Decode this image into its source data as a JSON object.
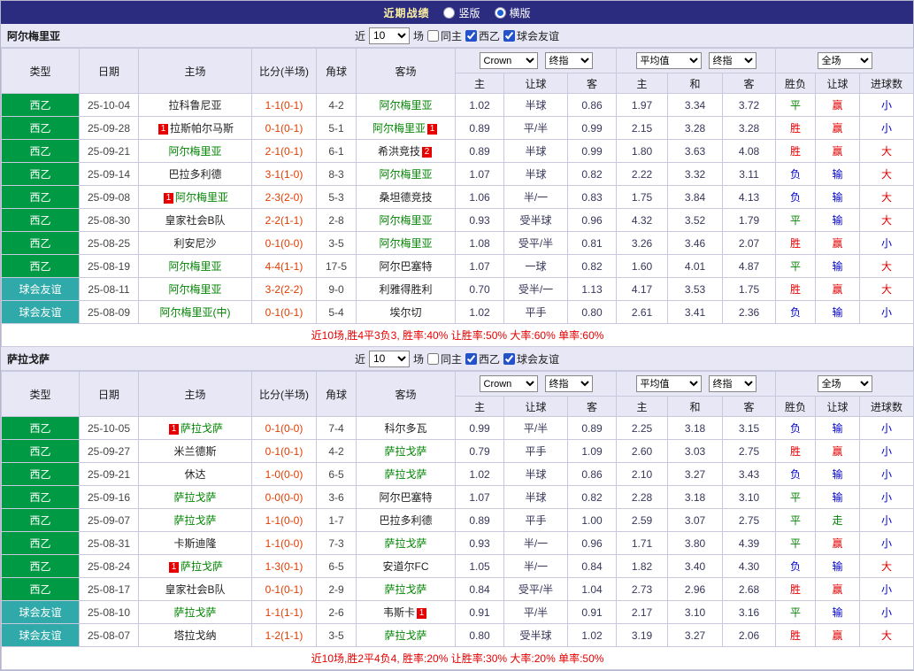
{
  "topbar": {
    "title": "近期战绩",
    "radios": [
      {
        "label": "竖版",
        "selected": false
      },
      {
        "label": "横版",
        "selected": true
      }
    ]
  },
  "focus_color": "#028402",
  "type_colors": {
    "西乙": "#009944",
    "球会友谊": "#2fa9a9"
  },
  "value_colors": {
    "胜": "#e60000",
    "平": "#028402",
    "负": "#0000cc",
    "赢": "#e60000",
    "输": "#0000cc",
    "走": "#028402",
    "大": "#e60000",
    "小": "#0000cc"
  },
  "sections": [
    {
      "team": "阿尔梅里亚",
      "filter": {
        "pre": "近",
        "count": "10",
        "post": "场",
        "checks": [
          {
            "label": "同主",
            "checked": false
          },
          {
            "label": "西乙",
            "checked": true
          },
          {
            "label": "球会友谊",
            "checked": true
          }
        ]
      },
      "controls": {
        "odds_source": "Crown",
        "odds_time": "终指",
        "euro_source": "平均值",
        "euro_time": "终指",
        "scope": "全场"
      },
      "columns": {
        "type": "类型",
        "date": "日期",
        "home": "主场",
        "score": "比分(半场)",
        "corner": "角球",
        "away": "客场",
        "ah": [
          "主",
          "让球",
          "客"
        ],
        "eu": [
          "主",
          "和",
          "客"
        ],
        "res": [
          "胜负",
          "让球",
          "进球数"
        ]
      },
      "rows": [
        {
          "type": "西乙",
          "date": "25-10-04",
          "home": {
            "name": "拉科鲁尼亚"
          },
          "score": "1-1(0-1)",
          "corner": "4-2",
          "away": {
            "name": "阿尔梅里亚",
            "focus": true
          },
          "ah": [
            "1.02",
            "半球",
            "0.86"
          ],
          "eu": [
            "1.97",
            "3.34",
            "3.72"
          ],
          "res": "平",
          "let": "赢",
          "goal": "小"
        },
        {
          "type": "西乙",
          "date": "25-09-28",
          "home": {
            "name": "拉斯帕尔马斯",
            "pre": "1"
          },
          "score": "0-1(0-1)",
          "corner": "5-1",
          "away": {
            "name": "阿尔梅里亚",
            "focus": true,
            "post": "1"
          },
          "ah": [
            "0.89",
            "平/半",
            "0.99"
          ],
          "eu": [
            "2.15",
            "3.28",
            "3.28"
          ],
          "res": "胜",
          "let": "赢",
          "goal": "小"
        },
        {
          "type": "西乙",
          "date": "25-09-21",
          "home": {
            "name": "阿尔梅里亚",
            "focus": true
          },
          "score": "2-1(0-1)",
          "corner": "6-1",
          "away": {
            "name": "希洪竞技",
            "post": "2"
          },
          "ah": [
            "0.89",
            "半球",
            "0.99"
          ],
          "eu": [
            "1.80",
            "3.63",
            "4.08"
          ],
          "res": "胜",
          "let": "赢",
          "goal": "大"
        },
        {
          "type": "西乙",
          "date": "25-09-14",
          "home": {
            "name": "巴拉多利德"
          },
          "score": "3-1(1-0)",
          "corner": "8-3",
          "away": {
            "name": "阿尔梅里亚",
            "focus": true
          },
          "ah": [
            "1.07",
            "半球",
            "0.82"
          ],
          "eu": [
            "2.22",
            "3.32",
            "3.11"
          ],
          "res": "负",
          "let": "输",
          "goal": "大"
        },
        {
          "type": "西乙",
          "date": "25-09-08",
          "home": {
            "name": "阿尔梅里亚",
            "focus": true,
            "pre": "1"
          },
          "score": "2-3(2-0)",
          "corner": "5-3",
          "away": {
            "name": "桑坦德竞技"
          },
          "ah": [
            "1.06",
            "半/一",
            "0.83"
          ],
          "eu": [
            "1.75",
            "3.84",
            "4.13"
          ],
          "res": "负",
          "let": "输",
          "goal": "大"
        },
        {
          "type": "西乙",
          "date": "25-08-30",
          "home": {
            "name": "皇家社会B队"
          },
          "score": "2-2(1-1)",
          "corner": "2-8",
          "away": {
            "name": "阿尔梅里亚",
            "focus": true
          },
          "ah": [
            "0.93",
            "受半球",
            "0.96"
          ],
          "eu": [
            "4.32",
            "3.52",
            "1.79"
          ],
          "res": "平",
          "let": "输",
          "goal": "大"
        },
        {
          "type": "西乙",
          "date": "25-08-25",
          "home": {
            "name": "利安尼沙"
          },
          "score": "0-1(0-0)",
          "corner": "3-5",
          "away": {
            "name": "阿尔梅里亚",
            "focus": true
          },
          "ah": [
            "1.08",
            "受平/半",
            "0.81"
          ],
          "eu": [
            "3.26",
            "3.46",
            "2.07"
          ],
          "res": "胜",
          "let": "赢",
          "goal": "小"
        },
        {
          "type": "西乙",
          "date": "25-08-19",
          "home": {
            "name": "阿尔梅里亚",
            "focus": true
          },
          "score": "4-4(1-1)",
          "corner": "17-5",
          "away": {
            "name": "阿尔巴塞特"
          },
          "ah": [
            "1.07",
            "一球",
            "0.82"
          ],
          "eu": [
            "1.60",
            "4.01",
            "4.87"
          ],
          "res": "平",
          "let": "输",
          "goal": "大"
        },
        {
          "type": "球会友谊",
          "date": "25-08-11",
          "home": {
            "name": "阿尔梅里亚",
            "focus": true
          },
          "score": "3-2(2-2)",
          "corner": "9-0",
          "away": {
            "name": "利雅得胜利"
          },
          "ah": [
            "0.70",
            "受半/一",
            "1.13"
          ],
          "eu": [
            "4.17",
            "3.53",
            "1.75"
          ],
          "res": "胜",
          "let": "赢",
          "goal": "大"
        },
        {
          "type": "球会友谊",
          "date": "25-08-09",
          "home": {
            "name": "阿尔梅里亚(中)",
            "focus": true
          },
          "score": "0-1(0-1)",
          "corner": "5-4",
          "away": {
            "name": "埃尔切"
          },
          "ah": [
            "1.02",
            "平手",
            "0.80"
          ],
          "eu": [
            "2.61",
            "3.41",
            "2.36"
          ],
          "res": "负",
          "let": "输",
          "goal": "小"
        }
      ],
      "summary": "近10场,胜4平3负3, 胜率:40% 让胜率:50% 大率:60% 单率:60%"
    },
    {
      "team": "萨拉戈萨",
      "filter": {
        "pre": "近",
        "count": "10",
        "post": "场",
        "checks": [
          {
            "label": "同主",
            "checked": false
          },
          {
            "label": "西乙",
            "checked": true
          },
          {
            "label": "球会友谊",
            "checked": true
          }
        ]
      },
      "controls": {
        "odds_source": "Crown",
        "odds_time": "终指",
        "euro_source": "平均值",
        "euro_time": "终指",
        "scope": "全场"
      },
      "columns": {
        "type": "类型",
        "date": "日期",
        "home": "主场",
        "score": "比分(半场)",
        "corner": "角球",
        "away": "客场",
        "ah": [
          "主",
          "让球",
          "客"
        ],
        "eu": [
          "主",
          "和",
          "客"
        ],
        "res": [
          "胜负",
          "让球",
          "进球数"
        ]
      },
      "rows": [
        {
          "type": "西乙",
          "date": "25-10-05",
          "home": {
            "name": "萨拉戈萨",
            "focus": true,
            "pre": "1"
          },
          "score": "0-1(0-0)",
          "corner": "7-4",
          "away": {
            "name": "科尔多瓦"
          },
          "ah": [
            "0.99",
            "平/半",
            "0.89"
          ],
          "eu": [
            "2.25",
            "3.18",
            "3.15"
          ],
          "res": "负",
          "let": "输",
          "goal": "小"
        },
        {
          "type": "西乙",
          "date": "25-09-27",
          "home": {
            "name": "米兰德斯"
          },
          "score": "0-1(0-1)",
          "corner": "4-2",
          "away": {
            "name": "萨拉戈萨",
            "focus": true
          },
          "ah": [
            "0.79",
            "平手",
            "1.09"
          ],
          "eu": [
            "2.60",
            "3.03",
            "2.75"
          ],
          "res": "胜",
          "let": "赢",
          "goal": "小"
        },
        {
          "type": "西乙",
          "date": "25-09-21",
          "home": {
            "name": "休达"
          },
          "score": "1-0(0-0)",
          "corner": "6-5",
          "away": {
            "name": "萨拉戈萨",
            "focus": true
          },
          "ah": [
            "1.02",
            "半球",
            "0.86"
          ],
          "eu": [
            "2.10",
            "3.27",
            "3.43"
          ],
          "res": "负",
          "let": "输",
          "goal": "小"
        },
        {
          "type": "西乙",
          "date": "25-09-16",
          "home": {
            "name": "萨拉戈萨",
            "focus": true
          },
          "score": "0-0(0-0)",
          "corner": "3-6",
          "away": {
            "name": "阿尔巴塞特"
          },
          "ah": [
            "1.07",
            "半球",
            "0.82"
          ],
          "eu": [
            "2.28",
            "3.18",
            "3.10"
          ],
          "res": "平",
          "let": "输",
          "goal": "小"
        },
        {
          "type": "西乙",
          "date": "25-09-07",
          "home": {
            "name": "萨拉戈萨",
            "focus": true
          },
          "score": "1-1(0-0)",
          "corner": "1-7",
          "away": {
            "name": "巴拉多利德"
          },
          "ah": [
            "0.89",
            "平手",
            "1.00"
          ],
          "eu": [
            "2.59",
            "3.07",
            "2.75"
          ],
          "res": "平",
          "let": "走",
          "goal": "小"
        },
        {
          "type": "西乙",
          "date": "25-08-31",
          "home": {
            "name": "卡斯迪隆"
          },
          "score": "1-1(0-0)",
          "corner": "7-3",
          "away": {
            "name": "萨拉戈萨",
            "focus": true
          },
          "ah": [
            "0.93",
            "半/一",
            "0.96"
          ],
          "eu": [
            "1.71",
            "3.80",
            "4.39"
          ],
          "res": "平",
          "let": "赢",
          "goal": "小"
        },
        {
          "type": "西乙",
          "date": "25-08-24",
          "home": {
            "name": "萨拉戈萨",
            "focus": true,
            "pre": "1"
          },
          "score": "1-3(0-1)",
          "corner": "6-5",
          "away": {
            "name": "安道尔FC"
          },
          "ah": [
            "1.05",
            "半/一",
            "0.84"
          ],
          "eu": [
            "1.82",
            "3.40",
            "4.30"
          ],
          "res": "负",
          "let": "输",
          "goal": "大"
        },
        {
          "type": "西乙",
          "date": "25-08-17",
          "home": {
            "name": "皇家社会B队"
          },
          "score": "0-1(0-1)",
          "corner": "2-9",
          "away": {
            "name": "萨拉戈萨",
            "focus": true
          },
          "ah": [
            "0.84",
            "受平/半",
            "1.04"
          ],
          "eu": [
            "2.73",
            "2.96",
            "2.68"
          ],
          "res": "胜",
          "let": "赢",
          "goal": "小"
        },
        {
          "type": "球会友谊",
          "date": "25-08-10",
          "home": {
            "name": "萨拉戈萨",
            "focus": true
          },
          "score": "1-1(1-1)",
          "corner": "2-6",
          "away": {
            "name": "韦斯卡",
            "post": "1"
          },
          "ah": [
            "0.91",
            "平/半",
            "0.91"
          ],
          "eu": [
            "2.17",
            "3.10",
            "3.16"
          ],
          "res": "平",
          "let": "输",
          "goal": "小"
        },
        {
          "type": "球会友谊",
          "date": "25-08-07",
          "home": {
            "name": "塔拉戈纳"
          },
          "score": "1-2(1-1)",
          "corner": "3-5",
          "away": {
            "name": "萨拉戈萨",
            "focus": true
          },
          "ah": [
            "0.80",
            "受半球",
            "1.02"
          ],
          "eu": [
            "3.19",
            "3.27",
            "2.06"
          ],
          "res": "胜",
          "let": "赢",
          "goal": "大"
        }
      ],
      "summary": "近10场,胜2平4负4, 胜率:20% 让胜率:30% 大率:20% 单率:50%"
    }
  ]
}
